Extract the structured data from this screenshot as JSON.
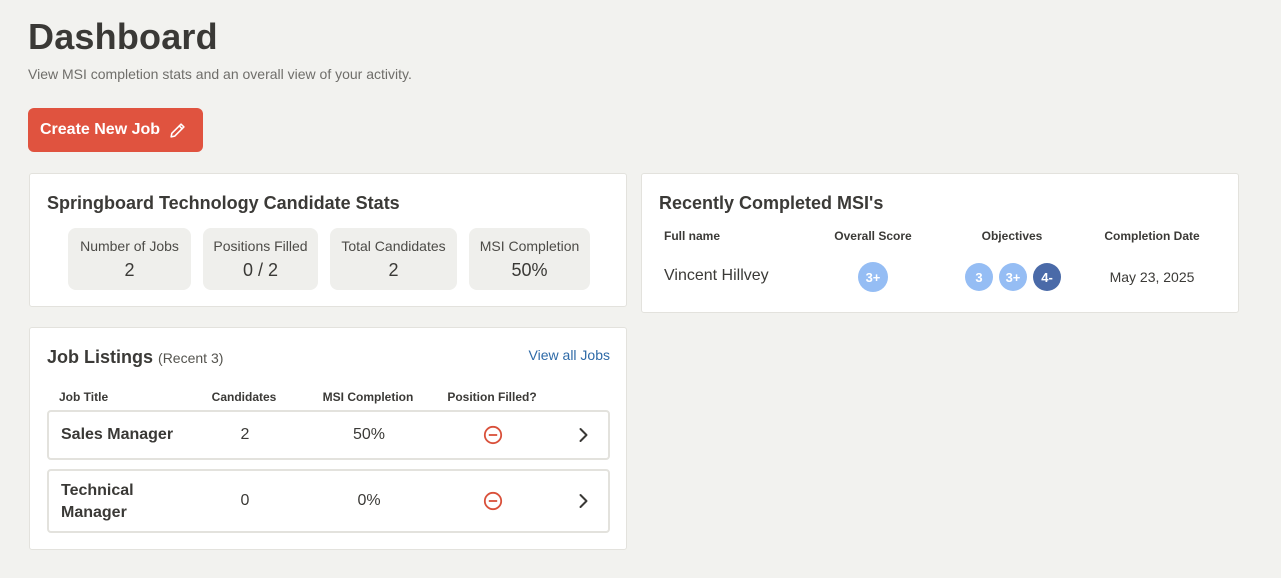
{
  "page": {
    "title": "Dashboard",
    "subtitle": "View MSI completion stats and an overall view of your activity.",
    "create_button": "Create New Job"
  },
  "stats": {
    "title": "Springboard Technology Candidate Stats",
    "items": [
      {
        "label": "Number of Jobs",
        "value": "2"
      },
      {
        "label": "Positions Filled",
        "value": "0 / 2"
      },
      {
        "label": "Total Candidates",
        "value": "2"
      },
      {
        "label": "MSI Completion",
        "value": "50%"
      }
    ]
  },
  "recent_msi": {
    "title": "Recently Completed MSI's",
    "headers": {
      "name": "Full name",
      "score": "Overall Score",
      "objectives": "Objectives",
      "date": "Completion Date"
    },
    "rows": [
      {
        "name": "Vincent Hillvey",
        "score": "3+",
        "objectives": [
          "3",
          "3+",
          "4-"
        ],
        "date": "May 23, 2025"
      }
    ]
  },
  "jobs": {
    "title": "Job Listings",
    "subtitle": "(Recent 3)",
    "view_all": "View all Jobs",
    "headers": {
      "title": "Job Title",
      "candidates": "Candidates",
      "msi": "MSI Completion",
      "filled": "Position Filled?"
    },
    "rows": [
      {
        "title": "Sales Manager",
        "candidates": "2",
        "msi": "50%",
        "filled_icon": "minus-circle-icon"
      },
      {
        "title": "Technical Manager",
        "candidates": "0",
        "msi": "0%",
        "filled_icon": "minus-circle-icon"
      }
    ]
  },
  "colors": {
    "background": "#f2f2ef",
    "primary_button": "#e0533f",
    "badge_light": "#95bdf4",
    "badge_dark": "#4a6aa8",
    "link": "#2e6aa7",
    "not_filled_icon": "#d9503a"
  }
}
